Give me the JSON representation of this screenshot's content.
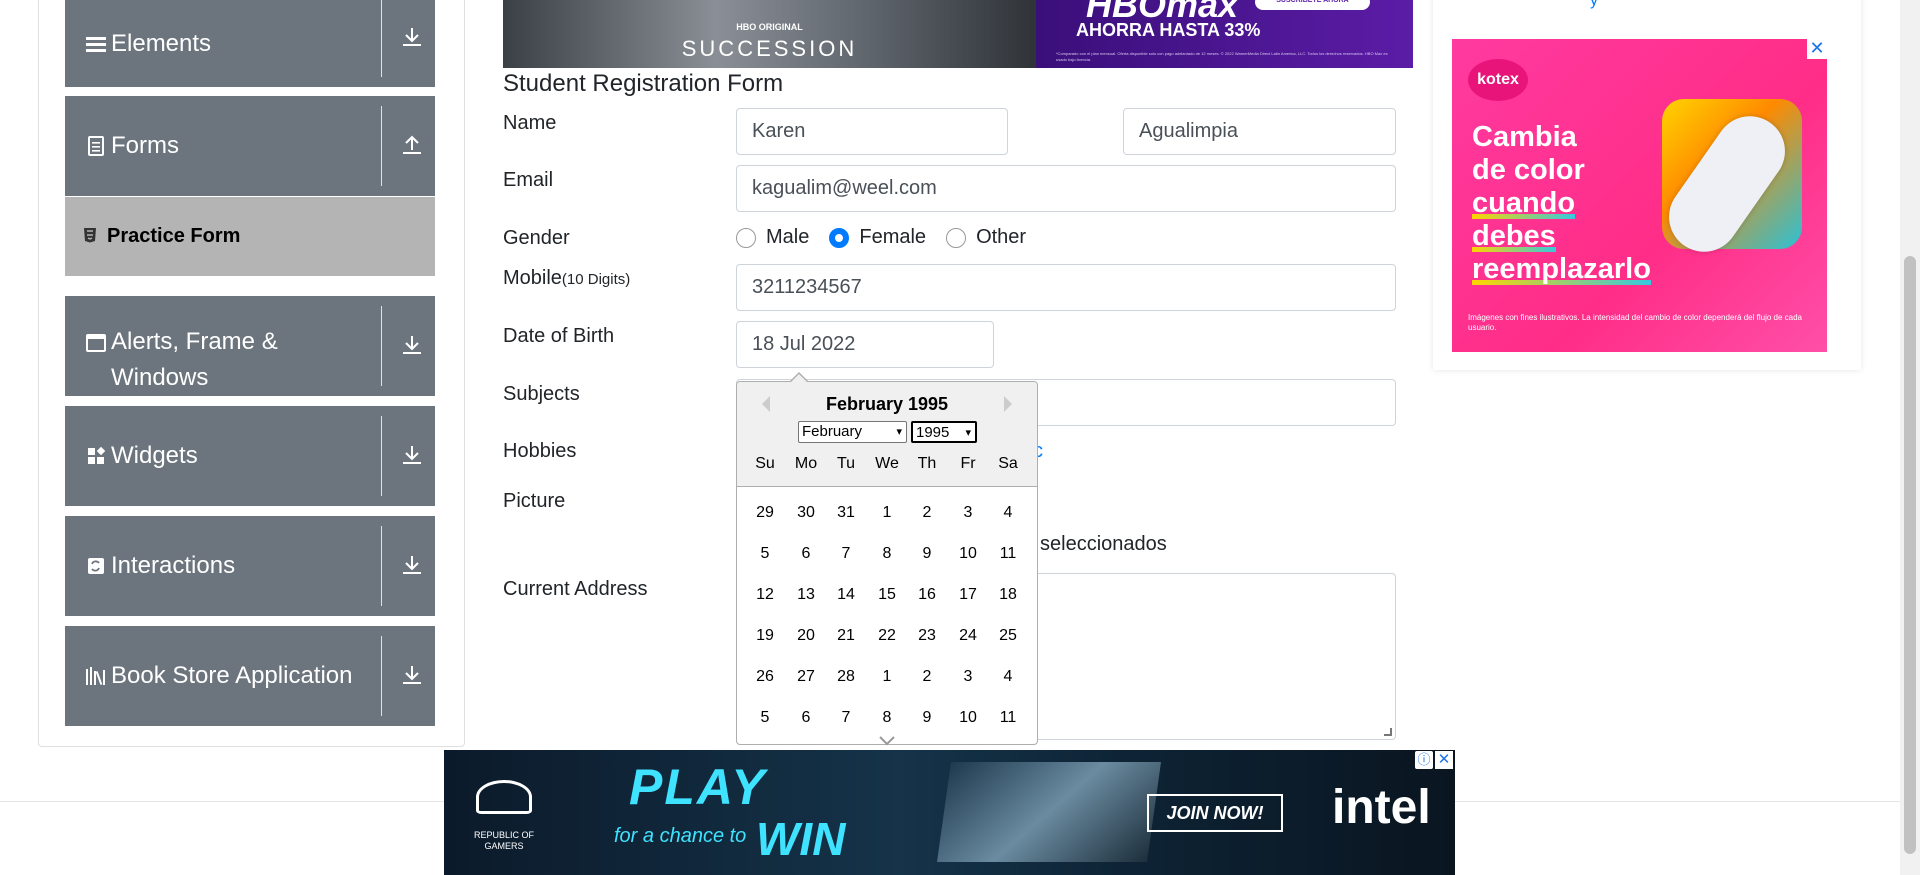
{
  "sidebar": {
    "groups": [
      {
        "title": "Elements",
        "icon": "hamburger-icon",
        "arrow": "download-arrow-icon"
      },
      {
        "title": "Forms",
        "icon": "document-icon",
        "arrow": "upload-arrow-icon"
      },
      {
        "title": "Alerts, Frame & Windows",
        "icon": "window-icon",
        "arrow": "download-arrow-icon"
      },
      {
        "title": "Widgets",
        "icon": "widgets-icon",
        "arrow": "download-arrow-icon"
      },
      {
        "title": "Interactions",
        "icon": "interactions-icon",
        "arrow": "download-arrow-icon"
      },
      {
        "title": "Book Store Application",
        "icon": "books-icon",
        "arrow": "download-arrow-icon"
      }
    ],
    "active_item": "Practice Form"
  },
  "top_ad": {
    "show_tag": "HBO ORIGINAL",
    "show_title": "SUCCESSION",
    "brand": "HBOmax",
    "cta": "SUSCRÍBETE AHORA",
    "offer": "AHORRA HASTA 33%",
    "fine_print": "*Comparado con el plan mensual. Oferta disponible solo con pago adelantado de 12 meses. © 2022 WarnerMedia Direct Latin America, LLC. Todos los derechos reservados. HBO Max es usado bajo licencia."
  },
  "form": {
    "title": "Student Registration Form",
    "labels": {
      "name": "Name",
      "email": "Email",
      "gender": "Gender",
      "mobile": "Mobile",
      "mobile_hint": "(10 Digits)",
      "dob": "Date of Birth",
      "subjects": "Subjects",
      "hobbies": "Hobbies",
      "picture": "Picture",
      "address": "Current Address"
    },
    "first_name": "Karen",
    "last_name": "Agualimpia",
    "email": "kagualim@weel.com",
    "gender_options": [
      "Male",
      "Female",
      "Other"
    ],
    "gender_selected": "Female",
    "mobile": "3211234567",
    "dob": "18 Jul 2022",
    "hobby_tail": "c",
    "upload_tail": "seleccionados"
  },
  "datepicker": {
    "title": "February 1995",
    "month_select": "February",
    "year_select": "1995",
    "weekdays": [
      "Su",
      "Mo",
      "Tu",
      "We",
      "Th",
      "Fr",
      "Sa"
    ],
    "weeks": [
      [
        "29",
        "30",
        "31",
        "1",
        "2",
        "3",
        "4"
      ],
      [
        "5",
        "6",
        "7",
        "8",
        "9",
        "10",
        "11"
      ],
      [
        "12",
        "13",
        "14",
        "15",
        "16",
        "17",
        "18"
      ],
      [
        "19",
        "20",
        "21",
        "22",
        "23",
        "24",
        "25"
      ],
      [
        "26",
        "27",
        "28",
        "1",
        "2",
        "3",
        "4"
      ],
      [
        "5",
        "6",
        "7",
        "8",
        "9",
        "10",
        "11"
      ]
    ]
  },
  "right_ad": {
    "brand": "kotex",
    "headline_lines": [
      "Cambia",
      "de color",
      "cuando",
      "debes",
      "reemplazarlo"
    ],
    "fine_print": "Imágenes con fines ilustrativos. La intensidad del cambio de color dependerá del flujo de cada usuario.",
    "close": "✕",
    "link_tail": "y"
  },
  "bottom_ad": {
    "brand": "REPUBLIC OF GAMERS",
    "play": "PLAY",
    "chance": "for a chance to",
    "win": "WIN",
    "cta": "JOIN NOW!",
    "sponsor": "intel",
    "info": "ⓘ",
    "close": "✕"
  },
  "colors": {
    "sidebar_group": "#6c757d",
    "sidebar_active": "#b4b4b4",
    "radio_checked": "#007bff",
    "link": "#007bff",
    "right_ad_bg": "#ff2d87",
    "bottom_ad_text": "#3fe2ff"
  }
}
